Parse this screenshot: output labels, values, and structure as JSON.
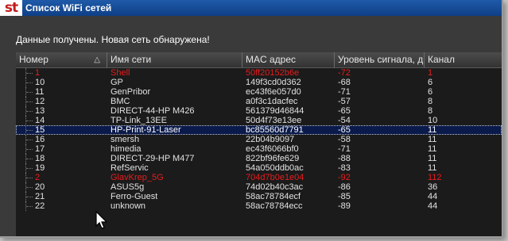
{
  "window": {
    "logo_text": "st",
    "title": "Список WiFi сетей"
  },
  "status_text": "Данные получены. Новая сеть обнаружена!",
  "colors": {
    "red": "#e81c1c",
    "normal": "#e2e2e2",
    "selected": "#ffffff"
  },
  "columns": [
    {
      "label": "Номер"
    },
    {
      "label": "Имя сети"
    },
    {
      "label": "MAC адрес"
    },
    {
      "label": "Уровень сигнала, дБ"
    },
    {
      "label": "Канал"
    }
  ],
  "rows": [
    {
      "num": "1",
      "name": "Shell",
      "mac": "50ff20152b6e",
      "signal": "-72",
      "channel": "1",
      "red": true,
      "selected": false
    },
    {
      "num": "10",
      "name": "GP",
      "mac": "149f3cd0d362",
      "signal": "-68",
      "channel": "6",
      "red": false,
      "selected": false
    },
    {
      "num": "11",
      "name": "GenPribor",
      "mac": "ec43f6e057d0",
      "signal": "-71",
      "channel": "6",
      "red": false,
      "selected": false
    },
    {
      "num": "12",
      "name": "BMC",
      "mac": "a0f3c1dacfec",
      "signal": "-57",
      "channel": "8",
      "red": false,
      "selected": false
    },
    {
      "num": "13",
      "name": "DIRECT-44-HP M426",
      "mac": "561379d46844",
      "signal": "-65",
      "channel": "8",
      "red": false,
      "selected": false
    },
    {
      "num": "14",
      "name": "TP-Link_13EE",
      "mac": "50d4f73e13ee",
      "signal": "-54",
      "channel": "10",
      "red": false,
      "selected": false
    },
    {
      "num": "15",
      "name": "HP-Print-91-Laser",
      "mac": "bc85560d7791",
      "signal": "-65",
      "channel": "11",
      "red": false,
      "selected": true
    },
    {
      "num": "16",
      "name": "smersh",
      "mac": "22b04b9097",
      "signal": "-58",
      "channel": "11",
      "red": false,
      "selected": false
    },
    {
      "num": "17",
      "name": "himedia",
      "mac": "ec43f6066bf0",
      "signal": "-71",
      "channel": "11",
      "red": false,
      "selected": false
    },
    {
      "num": "18",
      "name": "DIRECT-29-HP M477",
      "mac": "822bf96fe629",
      "signal": "-88",
      "channel": "11",
      "red": false,
      "selected": false
    },
    {
      "num": "19",
      "name": "RefServic",
      "mac": "54a050ddb0ac",
      "signal": "-83",
      "channel": "11",
      "red": false,
      "selected": false
    },
    {
      "num": "2",
      "name": "GlavKrep_5G",
      "mac": "704d7b0e1e04",
      "signal": "-92",
      "channel": "112",
      "red": true,
      "selected": false
    },
    {
      "num": "20",
      "name": "ASUS5g",
      "mac": "74d02b40c3ac",
      "signal": "-86",
      "channel": "36",
      "red": false,
      "selected": false
    },
    {
      "num": "21",
      "name": "Ferro-Guest",
      "mac": "58ac78784ecf",
      "signal": "-85",
      "channel": "44",
      "red": false,
      "selected": false
    },
    {
      "num": "22",
      "name": "unknown",
      "mac": "58ac78784ecc",
      "signal": "-89",
      "channel": "44",
      "red": false,
      "selected": false
    }
  ]
}
